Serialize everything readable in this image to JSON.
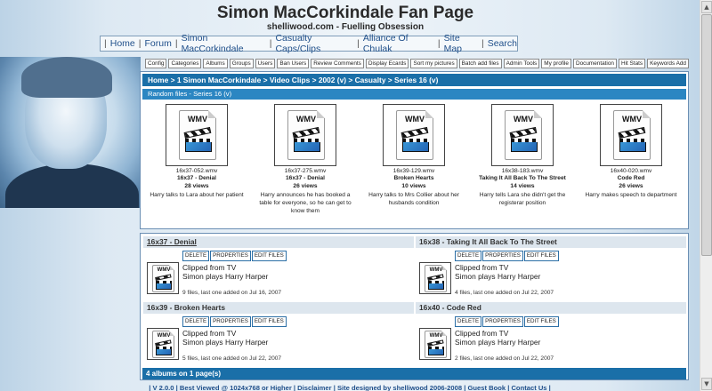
{
  "header": {
    "title": "Simon MacCorkindale Fan Page",
    "subtitle": "shelliwood.com - Fuelling Obsession"
  },
  "main_nav": {
    "items": [
      "Home",
      "Forum",
      "Simon MacCorkindale",
      "Casualty Caps/Clips",
      "Alliance Of Chulak",
      "Site Map",
      "Search"
    ]
  },
  "admin_bar": {
    "items": [
      "Config",
      "Categories",
      "Albums",
      "Groups",
      "Users",
      "Ban Users",
      "Review Comments",
      "Display Ecards",
      "Sort my pictures",
      "Batch add files",
      "Admin Tools",
      "My profile",
      "Documentation",
      "Hit Stats",
      "Keywords Add"
    ]
  },
  "breadcrumb": "Home > 1 Simon MacCorkindale > Video Clips > 2002 (v) > Casualty > Series 16 (v)",
  "random_header": "Random files - Series 16 (v)",
  "random_files": [
    {
      "icon": "WMV",
      "filename": "16x37-052.wmv",
      "title": "16x37 - Denial",
      "views": "28 views",
      "desc": "Harry talks to Lara about her patient"
    },
    {
      "icon": "WMV",
      "filename": "16x37-275.wmv",
      "title": "16x37 - Denial",
      "views": "26 views",
      "desc": "Harry announces he has booked a table for everyone, so he can get to know them"
    },
    {
      "icon": "WMV",
      "filename": "16x39-129.wmv",
      "title": "Broken Hearts",
      "views": "10 views",
      "desc": "Harry talks to Mrs Collier about her husbands condition"
    },
    {
      "icon": "WMV",
      "filename": "16x38-183.wmv",
      "title": "Taking It All Back To The Street",
      "views": "14 views",
      "desc": "Harry tells Lara she didn't get the registerar position"
    },
    {
      "icon": "WMV",
      "filename": "16x40-020.wmv",
      "title": "Code Red",
      "views": "26 views",
      "desc": "Harry makes speech to department"
    }
  ],
  "album_buttons": {
    "delete": "DELETE",
    "properties": "PROPERTIES",
    "edit": "EDIT FILES"
  },
  "albums": [
    {
      "title": "16x37 - Denial",
      "desc1": "Clipped from TV",
      "desc2": "Simon plays Harry Harper",
      "meta": "9 files, last one added on Jul 16, 2007"
    },
    {
      "title": "16x38 - Taking It All Back To The Street",
      "desc1": "Clipped from TV",
      "desc2": "Simon plays Harry Harper",
      "meta": "4 files, last one added on Jul 22, 2007"
    },
    {
      "title": "16x39 - Broken Hearts",
      "desc1": "Clipped from TV",
      "desc2": "Simon plays Harry Harper",
      "meta": "5 files, last one added on Jul 22, 2007"
    },
    {
      "title": "16x40 - Code Red",
      "desc1": "Clipped from TV",
      "desc2": "Simon plays Harry Harper",
      "meta": "2 files, last one added on Jul 22, 2007"
    }
  ],
  "albums_footer": "4 albums on 1 page(s)",
  "footer": {
    "items": [
      "V 2.0.0",
      "Best Viewed @ 1024x768 or Higher",
      "Disclaimer",
      "Site designed by shelliwood 2006-2008",
      "Guest Book",
      "Contact Us"
    ]
  }
}
